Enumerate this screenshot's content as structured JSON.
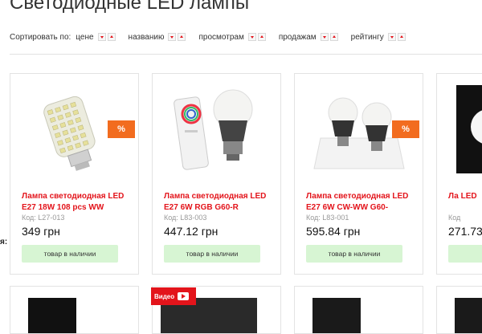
{
  "page": {
    "title": "Светодиодные LED лампы"
  },
  "sort": {
    "label": "Сортировать по:",
    "options": [
      {
        "label": "цене"
      },
      {
        "label": "названию"
      },
      {
        "label": "просмотрам"
      },
      {
        "label": "продажам"
      },
      {
        "label": "рейтингу"
      }
    ]
  },
  "products": [
    {
      "name": "Лампа светодиодная LED E27 18W 108 pcs WW",
      "code": "Код: L27-013",
      "price": "349 грн",
      "stock": "товар в наличии",
      "badge": "%"
    },
    {
      "name": "Лампа светодиодная LED E27 6W RGB G60-R",
      "code": "Код: L83-003",
      "price": "447.12 грн",
      "stock": "товар в наличии",
      "badge": ""
    },
    {
      "name": "Лампа светодиодная LED E27 6W CW-WW G60-",
      "code": "Код: L83-001",
      "price": "595.84 грн",
      "stock": "товар в наличии",
      "badge": "%"
    },
    {
      "name": "Ла LED",
      "code": "Код",
      "price": "271.73",
      "stock": "",
      "badge": ""
    }
  ],
  "second_row": {
    "video_label": "Видео"
  },
  "side_mark": "я:",
  "colors": {
    "accent": "#e3141b",
    "badge": "#f26c1f",
    "stock": "#d7f5d3"
  }
}
